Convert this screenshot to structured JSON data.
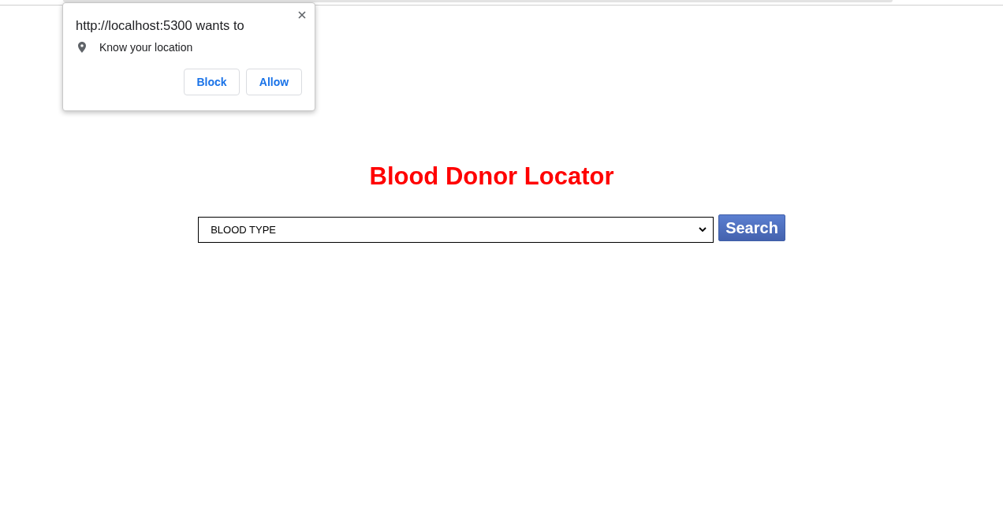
{
  "permission_prompt": {
    "title": "http://localhost:5300 wants to",
    "permission": "Know your location",
    "buttons": [
      {
        "label": "Block"
      },
      {
        "label": "Allow"
      }
    ]
  },
  "page": {
    "title": "Blood Donor Locator",
    "blood_type_select": {
      "value": "BLOOD TYPE"
    },
    "search_button": {
      "label": "Search"
    }
  }
}
